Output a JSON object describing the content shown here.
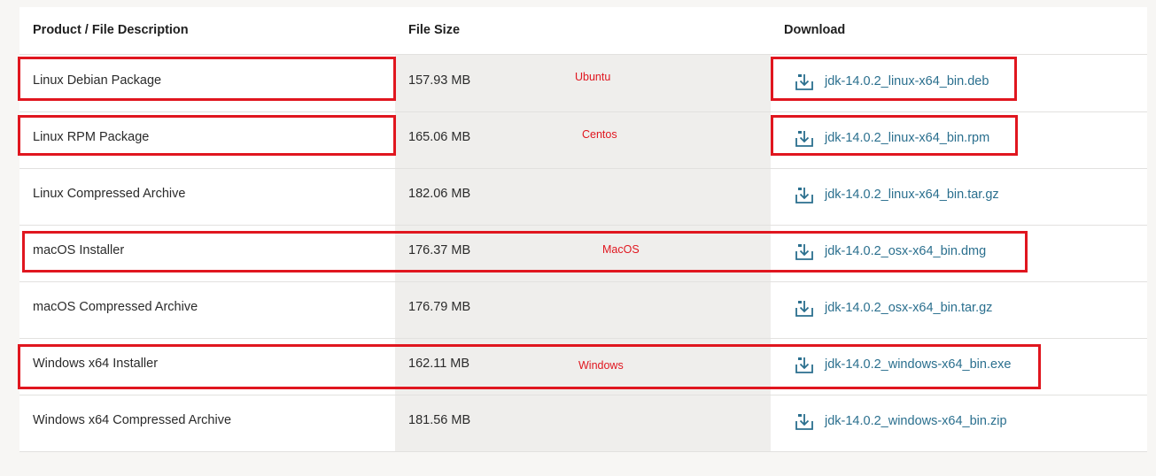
{
  "table": {
    "headers": {
      "description": "Product / File Description",
      "size": "File Size",
      "download": "Download"
    },
    "rows": [
      {
        "description": "Linux Debian Package",
        "size": "157.93 MB",
        "file": "jdk-14.0.2_linux-x64_bin.deb"
      },
      {
        "description": "Linux RPM Package",
        "size": "165.06 MB",
        "file": "jdk-14.0.2_linux-x64_bin.rpm"
      },
      {
        "description": "Linux Compressed Archive",
        "size": "182.06 MB",
        "file": "jdk-14.0.2_linux-x64_bin.tar.gz"
      },
      {
        "description": "macOS Installer",
        "size": "176.37 MB",
        "file": "jdk-14.0.2_osx-x64_bin.dmg"
      },
      {
        "description": "macOS Compressed Archive",
        "size": "176.79 MB",
        "file": "jdk-14.0.2_osx-x64_bin.tar.gz"
      },
      {
        "description": "Windows x64 Installer",
        "size": "162.11 MB",
        "file": "jdk-14.0.2_windows-x64_bin.exe"
      },
      {
        "description": "Windows x64 Compressed Archive",
        "size": "181.56 MB",
        "file": "jdk-14.0.2_windows-x64_bin.zip"
      }
    ]
  },
  "annotations": {
    "ubuntu": "Ubuntu",
    "centos": "Centos",
    "macos": "MacOS",
    "windows": "Windows"
  },
  "icons": {
    "download": "download-icon"
  },
  "colors": {
    "link": "#2a6f8e",
    "highlight": "#e0161f",
    "size_column_bg": "#efeeec",
    "page_bg": "#f7f6f4"
  }
}
